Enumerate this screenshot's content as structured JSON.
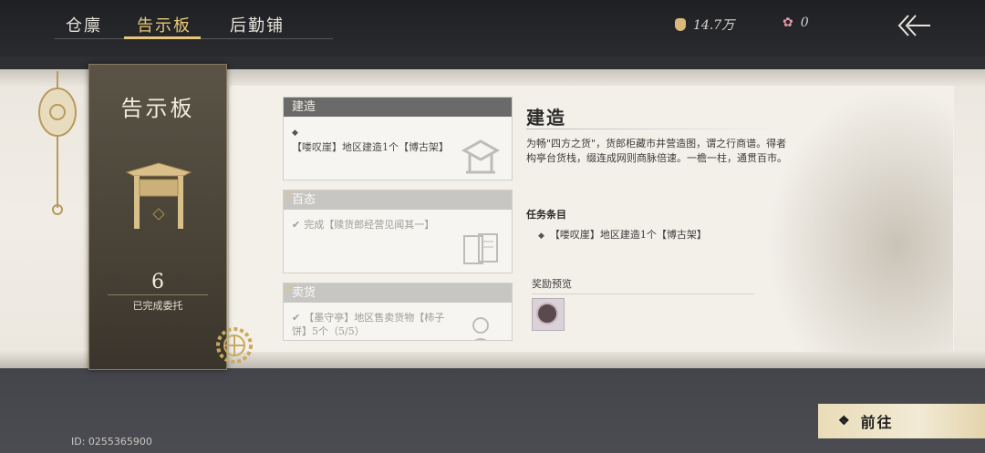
{
  "tabs": [
    {
      "label": "仓廪"
    },
    {
      "label": "告示板"
    },
    {
      "label": "后勤铺"
    }
  ],
  "currency": {
    "coins": "14.7万",
    "flowers": "0"
  },
  "icons": {
    "coin": "money-bag-icon",
    "flower": "flower-icon",
    "back": "back-arrow-icon"
  },
  "banner": {
    "title": "告示板",
    "count": "6",
    "count_label": "已完成委托"
  },
  "cards": [
    {
      "header": "建造",
      "text": "【喽叹崖】地区建造1个【博古架】"
    },
    {
      "header": "百态",
      "text": "完成【赎货郎经营见闻其一】"
    },
    {
      "header": "卖货",
      "text": "【墨守亭】地区售卖货物【柿子饼】5个（5/5）"
    }
  ],
  "detail": {
    "title": "建造",
    "description": "为畅\"四方之货\"，货郎柜藏市井营造图，谓之行商谱。得者构亭台货栈，缀连成网则商脉倍速。一檐一柱，通贯百市。",
    "tasks_label": "任务条目",
    "task": "【喽叹崖】地区建造1个【博古架】",
    "rewards_label": "奖励预览"
  },
  "go_button": "前往",
  "player_id": "ID: 0255365900",
  "colors": {
    "accent": "#e8c77a",
    "button": "#f2ead5",
    "banner": "#4a4438"
  }
}
